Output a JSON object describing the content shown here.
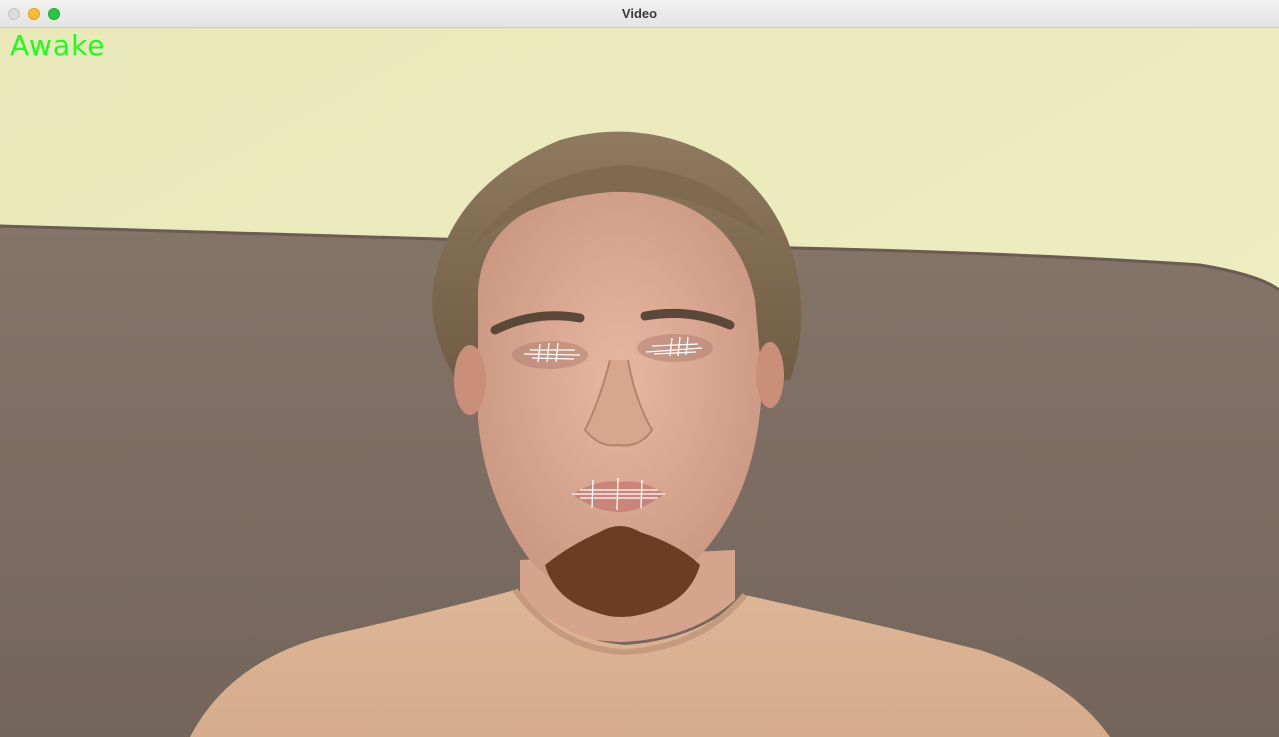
{
  "window": {
    "title": "Video"
  },
  "overlay": {
    "status": "Awake",
    "status_color": "#00ff00"
  },
  "landmark_color": "#ffffff",
  "icons": [
    "close-button",
    "minimize-button",
    "maximize-button"
  ]
}
